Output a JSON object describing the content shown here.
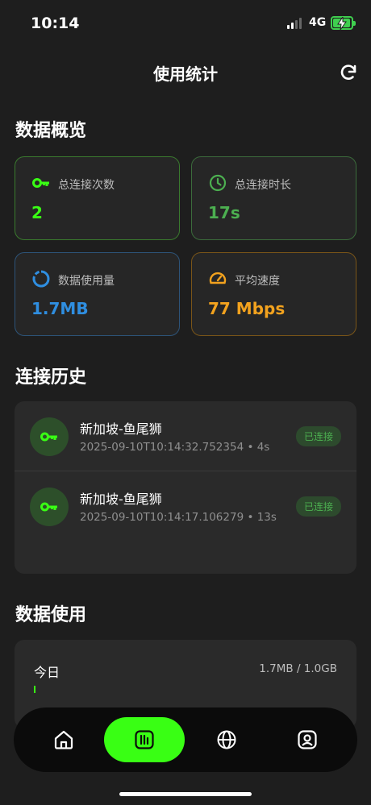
{
  "status_bar": {
    "time": "10:14",
    "network": "4G"
  },
  "header": {
    "title": "使用统计"
  },
  "overview": {
    "section_title": "数据概览",
    "cards": [
      {
        "label": "总连接次数",
        "value": "2",
        "icon": "key-icon",
        "color": "#39ff14",
        "border": "#3a7a2e"
      },
      {
        "label": "总连接时长",
        "value": "17s",
        "icon": "clock-icon",
        "color": "#4caf50",
        "border": "#3b6b3b"
      },
      {
        "label": "数据使用量",
        "value": "1.7MB",
        "icon": "donut-chart-icon",
        "color": "#2f8ee0",
        "border": "#2d5479"
      },
      {
        "label": "平均速度",
        "value": "77 Mbps",
        "icon": "speedometer-icon",
        "color": "#f2a21e",
        "border": "#7a5518"
      }
    ]
  },
  "history": {
    "section_title": "连接历史",
    "items": [
      {
        "title": "新加坡-鱼尾狮",
        "subtitle": "2025-09-10T10:14:32.752354 • 4s",
        "badge": "已连接"
      },
      {
        "title": "新加坡-鱼尾狮",
        "subtitle": "2025-09-10T10:14:17.106279 • 13s",
        "badge": "已连接"
      }
    ]
  },
  "usage": {
    "section_title": "数据使用",
    "today_label": "今日",
    "today_value": "1.7MB / 1.0GB",
    "today_fraction": 0.0017
  },
  "tabbar": {
    "tabs": [
      {
        "icon": "home-icon",
        "active": false
      },
      {
        "icon": "stats-icon",
        "active": true
      },
      {
        "icon": "globe-icon",
        "active": false
      },
      {
        "icon": "profile-icon",
        "active": false
      }
    ]
  },
  "colors": {
    "accent": "#39ff14",
    "background": "#1e1e1e",
    "card": "#262626"
  }
}
